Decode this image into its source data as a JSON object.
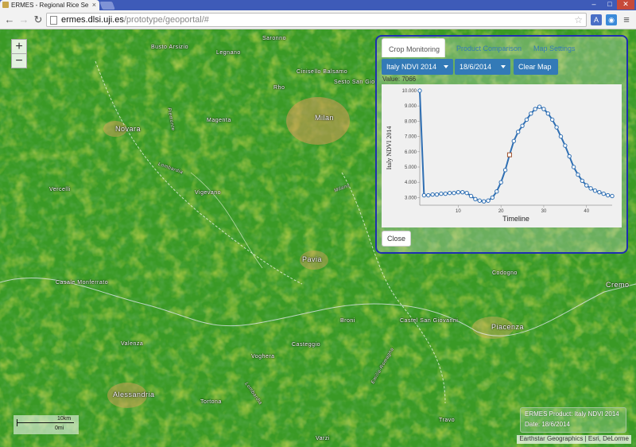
{
  "browser": {
    "tab_title": "ERMES - Regional Rice Se",
    "url_host": "ermes.dlsi.uji.es",
    "url_path": "/prototype/geoportal/#",
    "window_controls": [
      "–",
      "□",
      "✕"
    ],
    "icons": [
      "back-icon",
      "forward-icon",
      "reload-icon",
      "star-icon",
      "menu-icon"
    ]
  },
  "map": {
    "zoom_in": "+",
    "zoom_out": "−",
    "places": [
      {
        "name": "Saronno",
        "cls": ""
      },
      {
        "name": "Busto Arsizio",
        "cls": ""
      },
      {
        "name": "Legnano",
        "cls": ""
      },
      {
        "name": "Cinisello Balsamo",
        "cls": ""
      },
      {
        "name": "Rho",
        "cls": ""
      },
      {
        "name": "Novara",
        "cls": "city"
      },
      {
        "name": "Magenta",
        "cls": ""
      },
      {
        "name": "Milan",
        "cls": "city"
      },
      {
        "name": "Lombardia",
        "cls": "river"
      },
      {
        "name": "Vercelli",
        "cls": ""
      },
      {
        "name": "Vigevano",
        "cls": ""
      },
      {
        "name": "Pavia",
        "cls": "city"
      },
      {
        "name": "Casale Monferrato",
        "cls": ""
      },
      {
        "name": "Codogno",
        "cls": ""
      },
      {
        "name": "Cremo",
        "cls": "city"
      },
      {
        "name": "Castel San Giovanni",
        "cls": ""
      },
      {
        "name": "Piacenza",
        "cls": "city"
      },
      {
        "name": "Broni",
        "cls": ""
      },
      {
        "name": "Valenza",
        "cls": ""
      },
      {
        "name": "Casteggio",
        "cls": ""
      },
      {
        "name": "Voghera",
        "cls": ""
      },
      {
        "name": "Alessandria",
        "cls": "city"
      },
      {
        "name": "Tortona",
        "cls": ""
      },
      {
        "name": "Emilia-Romagna",
        "cls": "river"
      },
      {
        "name": "Lombardia",
        "cls": "river"
      },
      {
        "name": "Piemonte",
        "cls": "river"
      },
      {
        "name": "Travo",
        "cls": ""
      },
      {
        "name": "Varzi",
        "cls": ""
      },
      {
        "name": "Milano",
        "cls": "river"
      },
      {
        "name": "Sesto San Gio",
        "cls": ""
      }
    ],
    "scale_top": "10km",
    "scale_bottom": "0mi",
    "attribution": "Earthstar Geographics | Esri, DeLorme"
  },
  "panel": {
    "tabs": [
      "Crop Monitoring",
      "Product Comparison",
      "Map Settings"
    ],
    "active_tab": "Crop Monitoring",
    "product_select": "Italy NDVI 2014",
    "date_select": "18/6/2014",
    "clear_button": "Clear Map",
    "value_text": "Value: 7066",
    "close_button": "Close"
  },
  "legend": {
    "line1": "ERMES Product: Italy NDVI 2014",
    "line2": "Date: 18/6/2014"
  },
  "chart_data": {
    "type": "line",
    "title": "",
    "xlabel": "Timeline",
    "ylabel": "Italy NDVI 2014",
    "xlim": [
      1,
      46
    ],
    "ylim": [
      2500,
      10000
    ],
    "yticks": [
      "10.000",
      "9.000",
      "8.000",
      "7.000",
      "6.000",
      "5.000",
      "4.000",
      "3.000"
    ],
    "xticks": [
      "10",
      "20",
      "30",
      "40"
    ],
    "x": [
      1,
      2,
      3,
      4,
      5,
      6,
      7,
      8,
      9,
      10,
      11,
      12,
      13,
      14,
      15,
      16,
      17,
      18,
      19,
      20,
      21,
      22,
      23,
      24,
      25,
      26,
      27,
      28,
      29,
      30,
      31,
      32,
      33,
      34,
      35,
      36,
      37,
      38,
      39,
      40,
      41,
      42,
      43,
      44,
      45,
      46
    ],
    "values": [
      10000,
      3150,
      3150,
      3200,
      3200,
      3250,
      3250,
      3300,
      3300,
      3350,
      3350,
      3300,
      3100,
      2900,
      2800,
      2750,
      2800,
      3000,
      3400,
      4000,
      4800,
      5800,
      6700,
      7300,
      7700,
      8100,
      8500,
      8800,
      8950,
      8800,
      8500,
      8100,
      7600,
      7000,
      6400,
      5700,
      5000,
      4500,
      4100,
      3800,
      3600,
      3450,
      3350,
      3250,
      3150,
      3100
    ],
    "highlight_x": 22,
    "color": "#2f6fb3"
  }
}
